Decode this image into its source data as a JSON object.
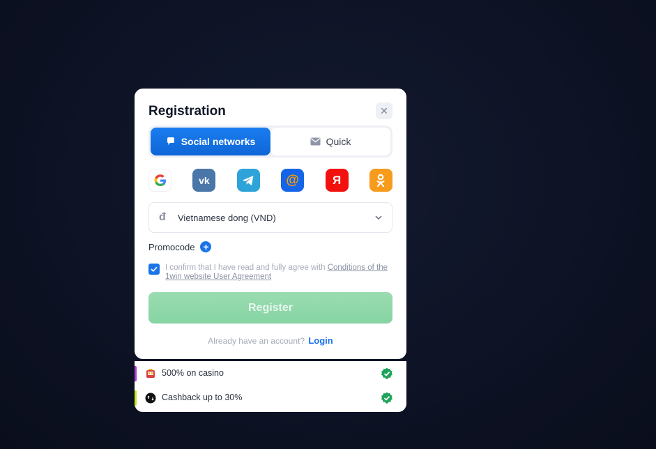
{
  "modal": {
    "title": "Registration",
    "close_icon": "close-icon"
  },
  "tabs": [
    {
      "label": "Social networks",
      "icon": "chat-bubble-icon",
      "active": true
    },
    {
      "label": "Quick",
      "icon": "envelope-icon",
      "active": false
    }
  ],
  "socials": [
    {
      "name": "Google",
      "icon": "google-icon",
      "color": "#ffffff",
      "glyph": "G"
    },
    {
      "name": "VK",
      "icon": "vk-icon",
      "color": "#4a76a8",
      "glyph": "vk"
    },
    {
      "name": "Telegram",
      "icon": "telegram-icon",
      "color": "#2ea3d9",
      "glyph": "➤"
    },
    {
      "name": "Mail.ru",
      "icon": "mailru-icon",
      "color": "#1565e8",
      "glyph": "@"
    },
    {
      "name": "Yandex",
      "icon": "yandex-icon",
      "color": "#f2110e",
      "glyph": "Я"
    },
    {
      "name": "Odnoklassniki",
      "icon": "ok-icon",
      "color": "#f79b1c",
      "glyph": "ок"
    }
  ],
  "currency": {
    "symbol": "đ",
    "value": "Vietnamese dong (VND)"
  },
  "promo": {
    "label": "Promocode",
    "plus": "+"
  },
  "agreement": {
    "checked": true,
    "text": "I confirm that I have read and fully agree with ",
    "link": "Conditions of the 1win website User Agreement"
  },
  "register_label": "Register",
  "login": {
    "prompt": "Already have an account?",
    "link": "Login"
  },
  "bonuses": [
    {
      "text": "500% on casino",
      "icon": "casino-icon",
      "bar_color": "#b03fd6"
    },
    {
      "text": "Cashback up to 30%",
      "icon": "cashback-icon",
      "bar_color": "#c6e620"
    }
  ],
  "colors": {
    "accent": "#1a73e8",
    "register_disabled": "#8fd8aa",
    "check_green": "#1fa35c"
  }
}
